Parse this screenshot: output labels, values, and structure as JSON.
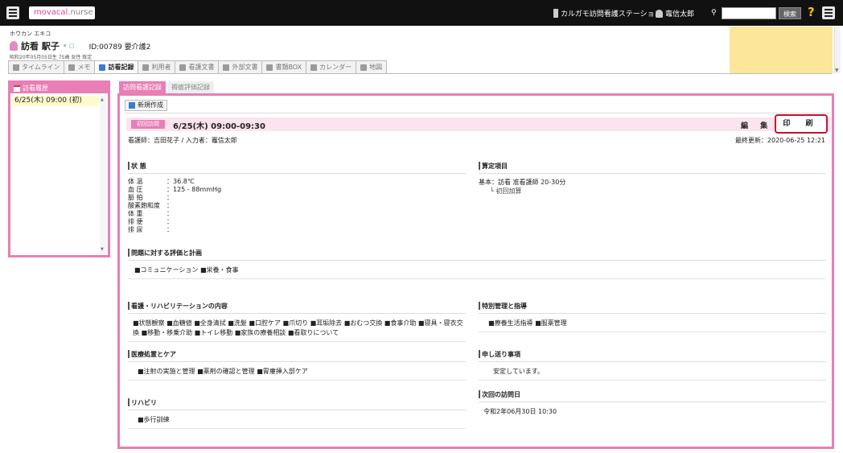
{
  "app": {
    "logo_prefix": "",
    "logo_brand": "movacal",
    "logo_suffix": ".nurse"
  },
  "topbar": {
    "station": "カルガモ訪問看護ステーション",
    "user": "竈信太郎",
    "search_button": "検索",
    "help": "?"
  },
  "patient": {
    "kana": "ホウカン エキコ",
    "name": "訪看 駅子",
    "id_text": "ID:00789 要介護2",
    "dob_text": "昭和20年05月05日生 75歳   女性        既定"
  },
  "tabs": [
    {
      "label": "タイムライン"
    },
    {
      "label": "メモ"
    },
    {
      "label": "訪看記録"
    },
    {
      "label": "利用者"
    },
    {
      "label": "看護文書"
    },
    {
      "label": "外部文書"
    },
    {
      "label": "書類BOX"
    },
    {
      "label": "カレンダー"
    },
    {
      "label": "地図"
    }
  ],
  "left_panel": {
    "title": "訪看履歴",
    "items": [
      "6/25(木) 09:00 (初)"
    ]
  },
  "subtabs": [
    "訪問看護記録",
    "褥瘡評価記録"
  ],
  "record": {
    "new_button": "新規作成",
    "badge": "初回訪問",
    "time": "6/25(木) 09:00-09:30",
    "edit": "編 集",
    "print": "印 刷",
    "staff": "看護師：吉田花子 / 入力者：竈信太郎",
    "updated": "最終更新：2020-06-25 12:21"
  },
  "status": {
    "title": "状  態",
    "vitals": [
      {
        "label": "体  温",
        "value": "：36.8℃"
      },
      {
        "label": "血  圧",
        "value": "：125 - 88mmHg"
      },
      {
        "label": "脈  拍",
        "value": "："
      },
      {
        "label": "酸素飽和度",
        "value": "："
      },
      {
        "label": "体  重",
        "value": "："
      },
      {
        "label": "排  便",
        "value": "："
      },
      {
        "label": "排  尿",
        "value": "："
      }
    ]
  },
  "billing": {
    "title": "算定項目",
    "line1": "基本：訪看 准看護師 20-30分",
    "line2": "└ 初回加算"
  },
  "evaluation": {
    "title": "問題に対する評価と計画",
    "text": "■コミュニケーション ■栄養・食事"
  },
  "nursing": {
    "title": "看護・リハビリテーションの内容",
    "text": "■状態観察 ■血糖値 ■全身清拭 ■洗髪 ■口腔ケア ■爪切り ■耳垢除去 ■おむつ交換 ■食事介助 ■寝具・寝衣交換 ■移動・移乗介助 ■トイレ移動 ■家族の療養相談 ■看取りについて"
  },
  "special": {
    "title": "特別管理と指導",
    "text": "■療養生活指導 ■服薬管理"
  },
  "medical": {
    "title": "医療処置とケア",
    "text": "■注射の実施と管理 ■薬剤の確認と管理 ■胃瘻挿入部ケア"
  },
  "handover": {
    "title": "申し送り事項",
    "text": "安定しています。"
  },
  "rehab": {
    "title": "リハビリ",
    "text": "■歩行訓練"
  },
  "next_visit": {
    "title": "次回の訪問日",
    "text": "令和2年06月30日 10:30"
  }
}
